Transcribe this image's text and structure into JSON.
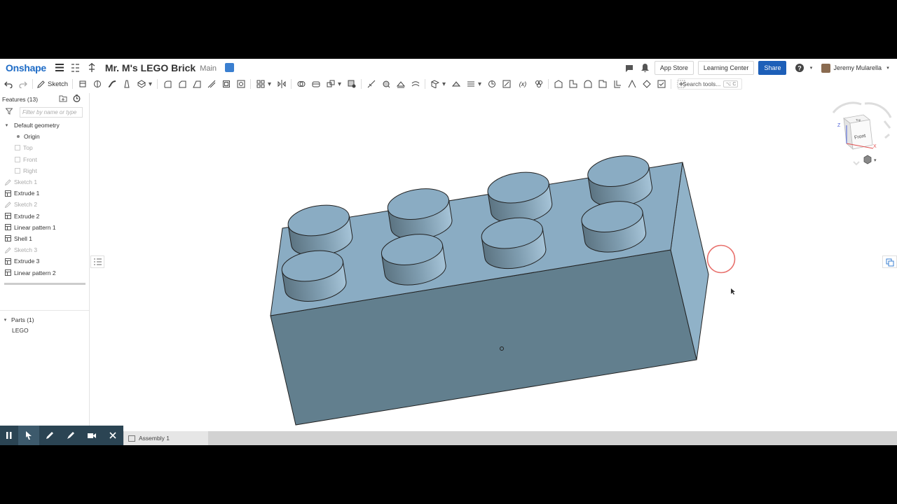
{
  "header": {
    "logo": "Onshape",
    "doc_title": "Mr. M's LEGO Brick",
    "branch": "Main",
    "app_store": "App Store",
    "learning_center": "Learning Center",
    "share": "Share",
    "user_name": "Jeremy Mularella"
  },
  "toolbar": {
    "sketch_label": "Sketch",
    "search_label": "Search tools...",
    "search_shortcut": "⌥ C"
  },
  "feature_panel": {
    "title": "Features (13)",
    "filter_placeholder": "Filter by name or type",
    "default_geometry": "Default geometry",
    "geometry_items": [
      "Origin",
      "Top",
      "Front",
      "Right"
    ],
    "features": [
      {
        "label": "Sketch 1",
        "kind": "sketch"
      },
      {
        "label": "Extrude 1",
        "kind": "feature"
      },
      {
        "label": "Sketch 2",
        "kind": "sketch"
      },
      {
        "label": "Extrude 2",
        "kind": "feature"
      },
      {
        "label": "Linear pattern 1",
        "kind": "feature"
      },
      {
        "label": "Shell 1",
        "kind": "feature"
      },
      {
        "label": "Sketch 3",
        "kind": "sketch"
      },
      {
        "label": "Extrude 3",
        "kind": "feature"
      },
      {
        "label": "Linear pattern 2",
        "kind": "feature"
      }
    ],
    "parts_title": "Parts (1)",
    "parts": [
      "LEGO"
    ]
  },
  "view_cube": {
    "top_face": "Top",
    "front_face": "Front",
    "axis_x": "X",
    "axis_z": "Z"
  },
  "tabs": {
    "assembly": "Assembly 1"
  },
  "colors": {
    "brand": "#1d6bc6",
    "share_button": "#1d5fb8",
    "model_top": "#8aacc3",
    "model_front": "#627f8e",
    "model_side": "#90b2c8",
    "recorder_bar": "#2b4453"
  }
}
